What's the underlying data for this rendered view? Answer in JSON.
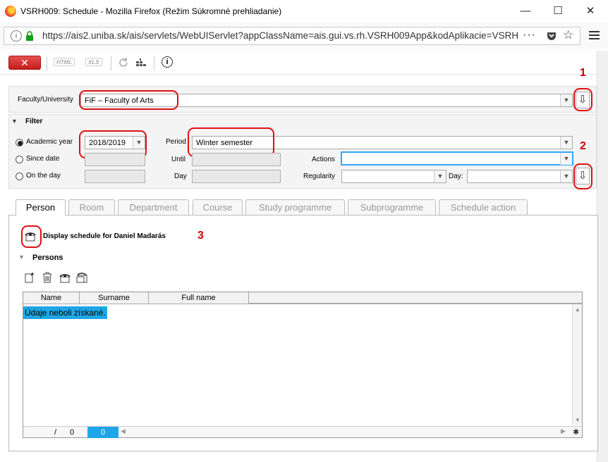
{
  "window": {
    "title": "VSRH009: Schedule - Mozilla Firefox (Režim Súkromné prehliadanie)",
    "controls": [
      "—",
      "☐",
      "✕"
    ]
  },
  "browser": {
    "url": "https://ais2.uniba.sk/ais/servlets/WebUIServlet?appClassName=ais.gui.vs.rh.VSRH009App&kodAplikacie=VSRH",
    "more": "···"
  },
  "toolbar": {
    "close_label": "✕",
    "html_label": "HTML",
    "xls_label": "XLS",
    "info_label": "i"
  },
  "faculty": {
    "label": "Faculty/University",
    "value": "FiF – Faculty of Arts"
  },
  "filter": {
    "title": "Filter",
    "academic_year_label": "Academic year",
    "academic_year_value": "2018/2019",
    "period_label": "Period",
    "period_value": "Winter semester",
    "since_date_label": "Since date",
    "until_label": "Until",
    "actions_label": "Actions",
    "on_the_day_label": "On the day",
    "day_label": "Day",
    "regularity_label": "Regularity",
    "day2_label": "Day:"
  },
  "annotations": [
    "1",
    "2",
    "3"
  ],
  "tabs": [
    {
      "label": "Person"
    },
    {
      "label": "Room"
    },
    {
      "label": "Department"
    },
    {
      "label": "Course"
    },
    {
      "label": "Study programme"
    },
    {
      "label": "Subprogramme"
    },
    {
      "label": "Schedule action"
    }
  ],
  "person": {
    "display_schedule_label": "Display schedule for Daniel Madarás",
    "persons_title": "Persons",
    "columns": [
      "Name",
      "Surname",
      "Full name"
    ],
    "empty_text": "Údaje neboli získané.",
    "footer_slash": "/",
    "footer_total": "0",
    "footer_current": "0"
  },
  "colors": {
    "accent": "#1ea7e8",
    "close": "#d32f2f",
    "annotation": "#cc0000"
  }
}
